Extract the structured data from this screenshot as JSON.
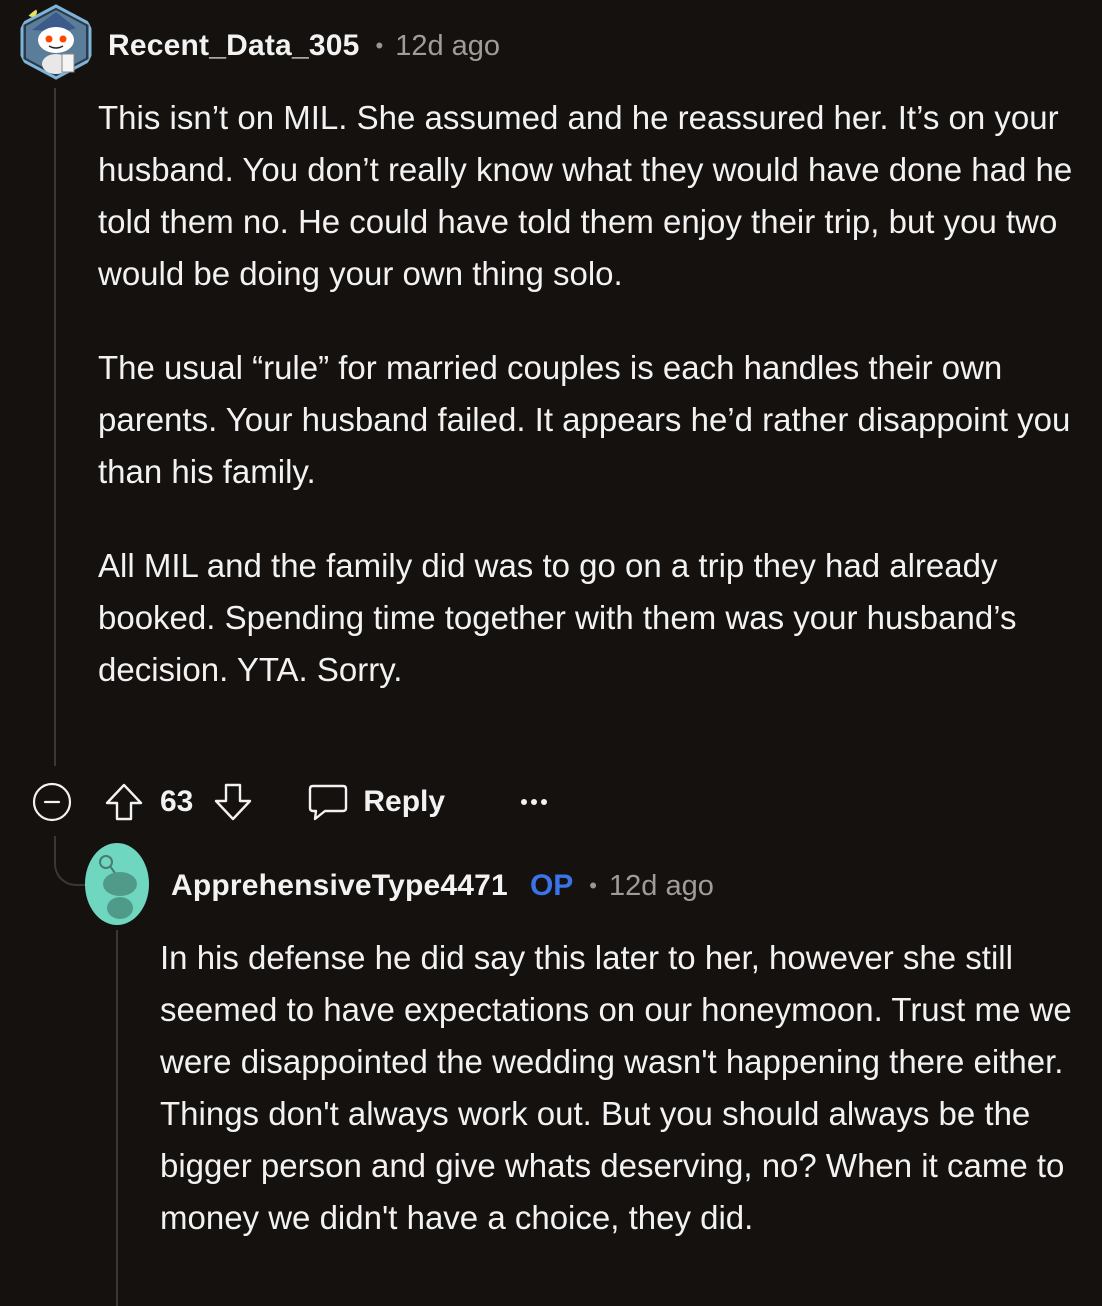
{
  "comments": [
    {
      "username": "Recent_Data_305",
      "separator": "•",
      "time": "12d ago",
      "avatar_icon": "reddit-snoo-wizard-avatar",
      "paragraphs": [
        "This isn’t on MIL. She assumed and he reassured her. It’s on your husband. You don’t really know what they would have done had he told them no. He could have told them enjoy their trip, but you two would be doing your own thing solo.",
        "The usual “rule” for married couples is each handles their own parents. Your husband failed. It appears he’d rather disappoint you than his family.",
        "All MIL and the family did was to go on a trip they had already booked. Spending time together with them was your husband’s decision. YTA. Sorry."
      ],
      "actions": {
        "collapse_icon": "minus-circle-icon",
        "upvote_icon": "upvote-arrow-icon",
        "vote_count": "63",
        "downvote_icon": "downvote-arrow-icon",
        "reply_icon": "speech-bubble-icon",
        "reply_label": "Reply",
        "more_icon": "ellipsis-icon"
      }
    },
    {
      "username": "ApprehensiveType4471",
      "badge": "OP",
      "separator": "•",
      "time": "12d ago",
      "avatar_icon": "reddit-snoo-avatar",
      "paragraphs": [
        "In his defense he did say this later to her, however she still seemed to have expectations on our honeymoon. Trust me we were disappointed the wedding wasn't happening there either. Things don't always work out. But you should always be the bigger person and give whats deserving, no? When it came to money we didn't have a choice, they did."
      ]
    }
  ],
  "colors": {
    "background": "#14110f",
    "text": "#f2f2f2",
    "muted": "#a09c98",
    "op_badge": "#3b74e8",
    "thread_line": "#3a3734",
    "avatar2_bg": "#6fd6c0"
  }
}
